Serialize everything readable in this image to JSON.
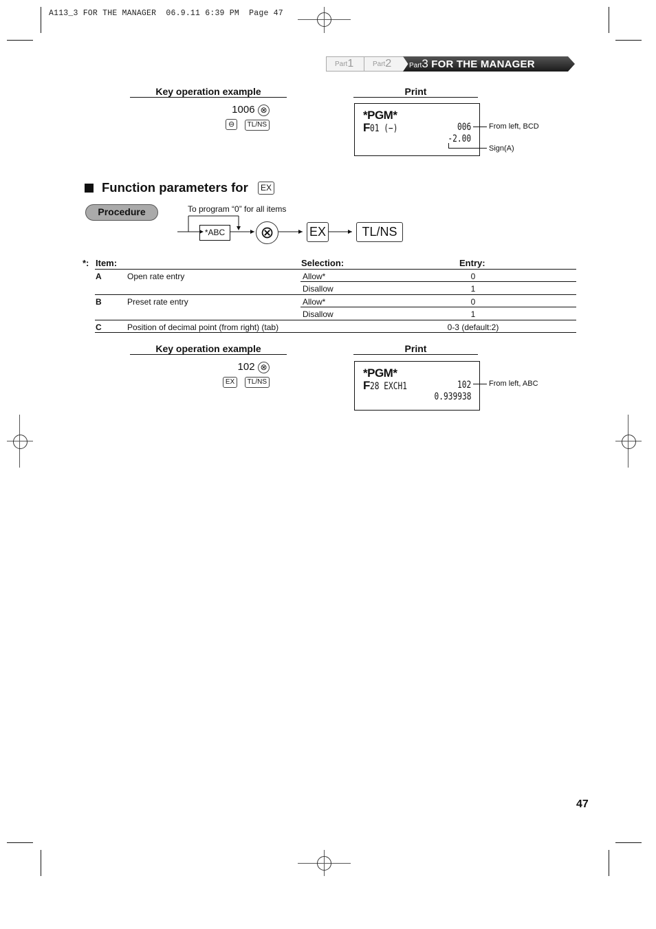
{
  "slug": {
    "text": "A113_3 FOR THE MANAGER  06.9.11 6:39 PM  Page 47"
  },
  "part_nav": {
    "part1": {
      "prefix": "Part",
      "num": "1"
    },
    "part2": {
      "prefix": "Part",
      "num": "2"
    },
    "part3": {
      "prefix": "Part",
      "num": "3",
      "title": "FOR THE MANAGER"
    }
  },
  "example1": {
    "key_heading": "Key operation example",
    "entry_number": "1006",
    "multiply_key": "⊗",
    "minus_key": "⊖",
    "tlns_key": "TL/NS",
    "print_heading": "Print",
    "print": {
      "header": "*PGM*",
      "line1_left_f": "F",
      "line1_left_rest": "01 (−)",
      "line1_right": "006",
      "line2_right": "-2.00"
    },
    "annotations": {
      "bcd": "From left, BCD",
      "sign": "Sign(A)"
    }
  },
  "section": {
    "title": "Function parameters for",
    "key": "EX"
  },
  "procedure": {
    "label": "Procedure",
    "loop_note": "To program “0” for all items",
    "abc_box": "*ABC",
    "multiply_key": "⊗",
    "ex_key": "EX",
    "tlns_key": "TL/NS"
  },
  "table": {
    "marker": "*:",
    "headers": {
      "item": "Item:",
      "selection": "Selection:",
      "entry": "Entry:"
    },
    "rows": [
      {
        "code": "A",
        "item": "Open rate entry",
        "selection": "Allow*",
        "entry": "0"
      },
      {
        "code": "",
        "item": "",
        "selection": "Disallow",
        "entry": "1"
      },
      {
        "code": "B",
        "item": "Preset rate entry",
        "selection": "Allow*",
        "entry": "0"
      },
      {
        "code": "",
        "item": "",
        "selection": "Disallow",
        "entry": "1"
      },
      {
        "code": "C",
        "item": "Position of decimal point (from right) (tab)",
        "selection": "",
        "entry": "0-3 (default:2)"
      }
    ]
  },
  "example2": {
    "key_heading": "Key operation example",
    "entry_number": "102",
    "multiply_key": "⊗",
    "ex_key": "EX",
    "tlns_key": "TL/NS",
    "print_heading": "Print",
    "print": {
      "header": "*PGM*",
      "line1_left_f": "F",
      "line1_left_rest": "28 EXCH1",
      "line1_right": "102",
      "line2_right": "0.939938"
    },
    "annotations": {
      "abc": "From left, ABC"
    }
  },
  "page_number": "47"
}
